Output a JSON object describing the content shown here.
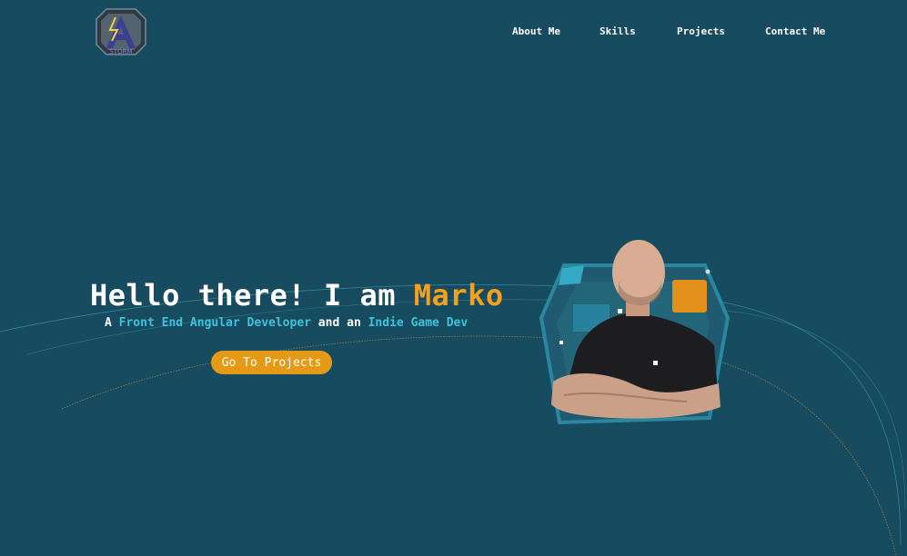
{
  "brand": {
    "logo_letter": "A",
    "logo_text": "STORM"
  },
  "nav": {
    "items": [
      {
        "label": "About Me"
      },
      {
        "label": "Skills"
      },
      {
        "label": "Projects"
      },
      {
        "label": "Contact Me"
      }
    ]
  },
  "hero": {
    "title_prefix": "Hello there! I am ",
    "name": "Marko",
    "subtitle_a": "A ",
    "role_1": "Front End Angular Developer",
    "subtitle_and": " and an ",
    "role_2": "Indie Game Dev",
    "cta_label": "Go To Projects"
  },
  "colors": {
    "background": "#174b5f",
    "accent_orange": "#f5a01c",
    "accent_cyan": "#3fc3da",
    "button": "#e59a17"
  }
}
